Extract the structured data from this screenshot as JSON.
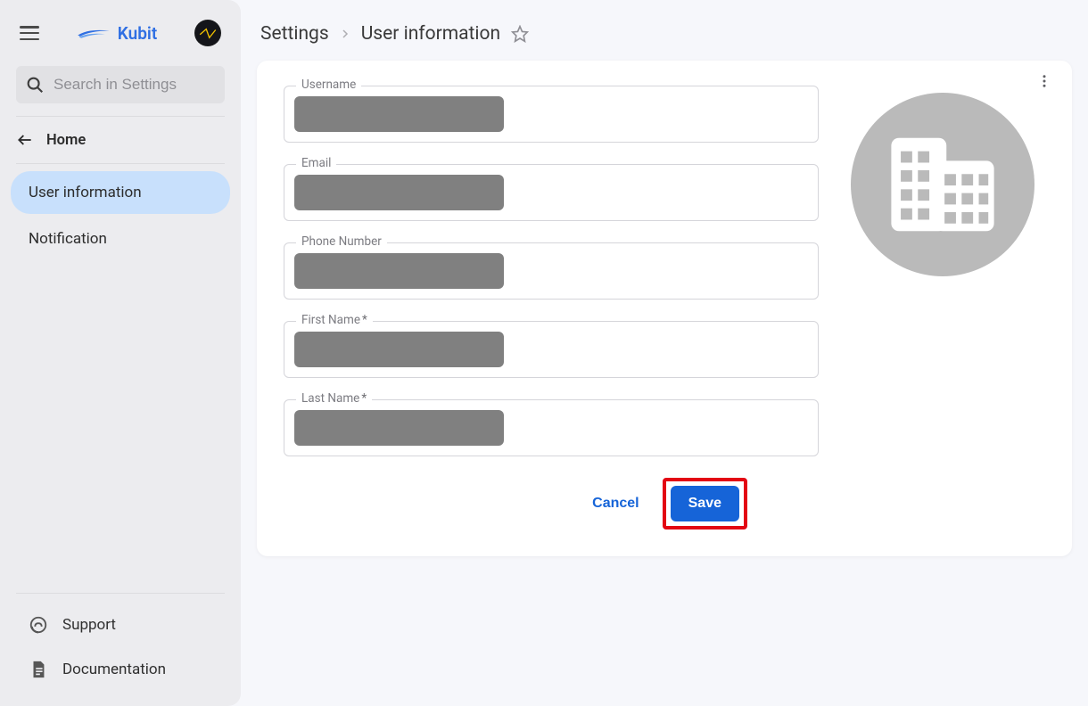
{
  "brand": {
    "name": "Kubit"
  },
  "search": {
    "placeholder": "Search in Settings"
  },
  "nav": {
    "home_label": "Home",
    "items": [
      {
        "label": "User information",
        "active": true
      },
      {
        "label": "Notification",
        "active": false
      }
    ]
  },
  "bottom": {
    "support_label": "Support",
    "documentation_label": "Documentation"
  },
  "breadcrumb": {
    "root": "Settings",
    "current": "User information"
  },
  "form": {
    "fields": {
      "username": {
        "label": "Username",
        "required": false
      },
      "email": {
        "label": "Email",
        "required": false
      },
      "phone": {
        "label": "Phone Number",
        "required": false
      },
      "first_name": {
        "label": "First Name",
        "required": true
      },
      "last_name": {
        "label": "Last Name",
        "required": true
      }
    },
    "actions": {
      "cancel_label": "Cancel",
      "save_label": "Save"
    }
  },
  "colors": {
    "primary": "#1664d8",
    "sidebar_bg": "#ececef",
    "active_nav_bg": "#c8e0fc",
    "highlight": "#e30613"
  }
}
